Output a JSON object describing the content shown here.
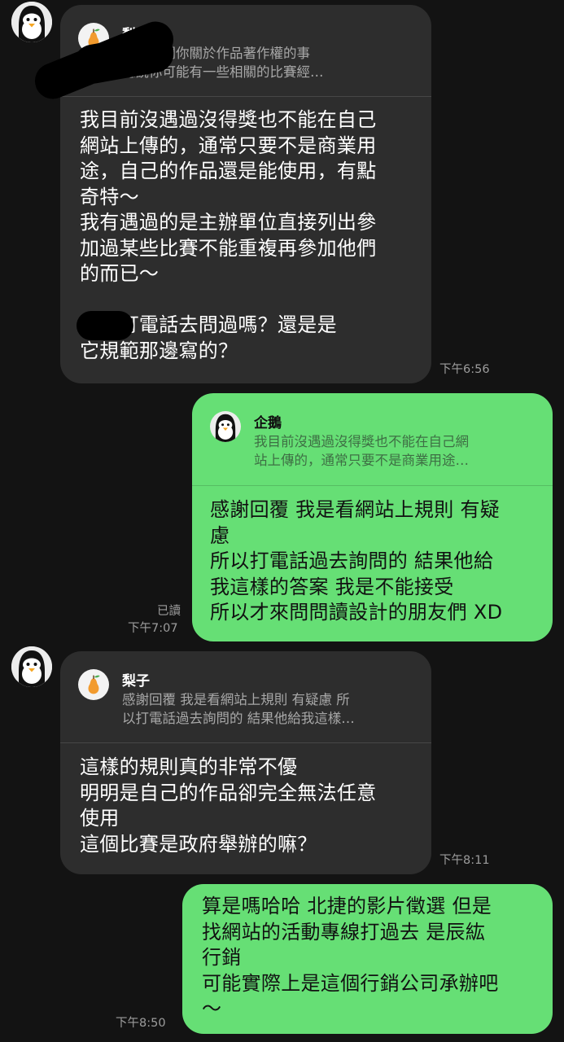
{
  "contacts": {
    "sender_name": "梨子",
    "me_name": "企鵝"
  },
  "messages": [
    {
      "direction": "incoming",
      "quote_name": "梨子",
      "quote_text": "我想問問你關於作品著作權的事\n聽說你可能有一些相關的比賽經…",
      "text": "我目前沒遇過沒得獎也不能在自己\n網站上傳的，通常只要不是商業用\n途，自己的作品還是能使用，有點\n奇特～\n我有遇過的是主辦單位直接列出參\n加過某些比賽不能重複再參加他們\n的而已～\n\n是有打電話去問過嗎？還是是\n它規範那邊寫的？",
      "time": "下午6:56"
    },
    {
      "direction": "outgoing",
      "quote_name": "企鵝",
      "quote_text": "我目前沒遇過沒得獎也不能在自己網\n站上傳的，通常只要不是商業用途…",
      "text": "感謝回覆 我是看網站上規則 有疑\n慮\n所以打電話過去詢問的 結果他給\n我這樣的答案 我是不能接受\n所以才來問問讀設計的朋友們 XD",
      "read": "已讀",
      "time": "下午7:07"
    },
    {
      "direction": "incoming",
      "quote_name": "梨子",
      "quote_text": "感謝回覆 我是看網站上規則 有疑慮 所\n以打電話過去詢問的 結果他給我這樣…",
      "text": "這樣的規則真的非常不優\n明明是自己的作品卻完全無法任意\n使用\n這個比賽是政府舉辦的嘛？",
      "time": "下午8:11"
    },
    {
      "direction": "outgoing",
      "text": "算是嗎哈哈 北捷的影片徵選 但是\n找網站的活動專線打過去 是辰紘\n行銷\n可能實際上是這個行銷公司承辦吧\n～",
      "time": "下午8:50"
    }
  ],
  "colors": {
    "background": "#131313",
    "incoming_bubble": "#2d2d2d",
    "outgoing_bubble": "#66df75",
    "timestamp": "#9c9c9c"
  },
  "icons": {
    "sender_avatar": "penguin-avatar-icon",
    "quote_avatar_pear": "pear-avatar-icon",
    "quote_avatar_penguin": "penguin-avatar-icon"
  }
}
